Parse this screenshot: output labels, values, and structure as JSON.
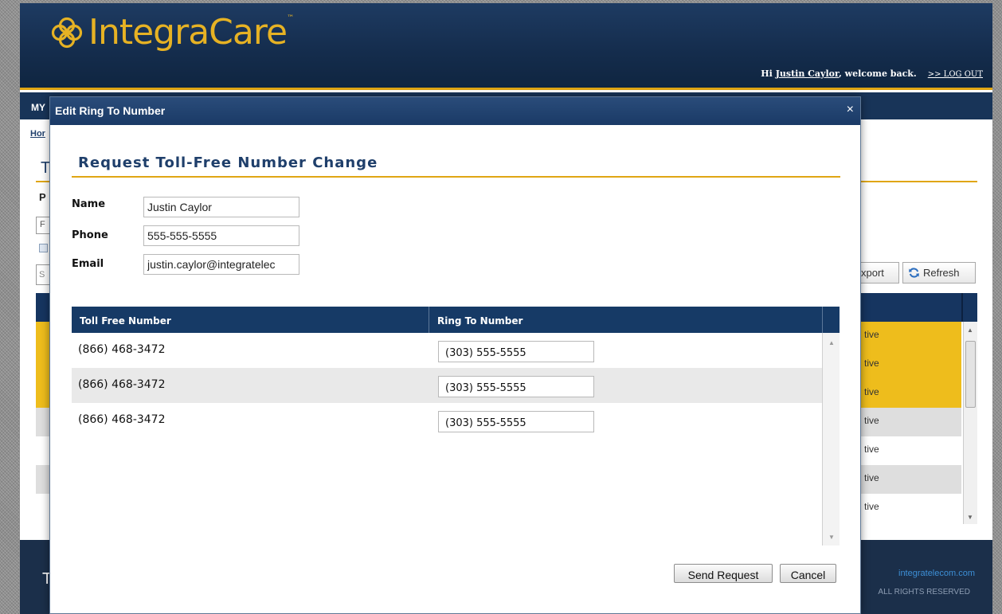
{
  "header": {
    "brand_name_part1": "Integra",
    "brand_name_part2": "Care",
    "welcome_prefix": "Hi ",
    "welcome_user": "Justin Caylor",
    "welcome_suffix": ", welcome back.",
    "logout_label": ">> LOG OUT"
  },
  "background": {
    "nav_peek": "MY",
    "breadcrumb_peek": "Hor",
    "title_peek": "T",
    "section_peek": "P",
    "select_peek": "F",
    "search_peek": "S",
    "export_label": "xport",
    "refresh_label": "Refresh",
    "status_rows": [
      {
        "status": "tive",
        "style": "gold"
      },
      {
        "status": "tive",
        "style": "gold"
      },
      {
        "status": "tive",
        "style": "gold"
      },
      {
        "status": "tive",
        "style": "grey"
      },
      {
        "status": "tive",
        "style": "white"
      },
      {
        "status": "tive",
        "style": "grey"
      },
      {
        "status": "tive",
        "style": "white"
      }
    ],
    "footer_peek": "T",
    "footer_link": "integratelecom.com",
    "footer_rights": "ALL RIGHTS RESERVED"
  },
  "modal": {
    "title": "Edit Ring To Number",
    "close_glyph": "×",
    "heading": "Request Toll-Free Number Change",
    "fields": {
      "name_label": "Name",
      "name_value": "Justin Caylor",
      "phone_label": "Phone",
      "phone_value": "555-555-5555",
      "email_label": "Email",
      "email_value": "justin.caylor@integratelec"
    },
    "table": {
      "col_toll_free": "Toll Free Number",
      "col_ring_to": "Ring To Number",
      "rows": [
        {
          "toll_free": "(866) 468-3472",
          "ring_to": "(303) 555-5555"
        },
        {
          "toll_free": "(866) 468-3472",
          "ring_to": "(303) 555-5555"
        },
        {
          "toll_free": "(866) 468-3472",
          "ring_to": "(303) 555-5555"
        }
      ]
    },
    "send_label": "Send Request",
    "cancel_label": "Cancel"
  },
  "colors": {
    "navy": "#163a66",
    "gold": "#e0a613",
    "highlight_gold": "#eebd1c"
  },
  "icons": {
    "logo": "integracare-logo-icon",
    "refresh": "refresh-icon",
    "close": "close-icon"
  }
}
